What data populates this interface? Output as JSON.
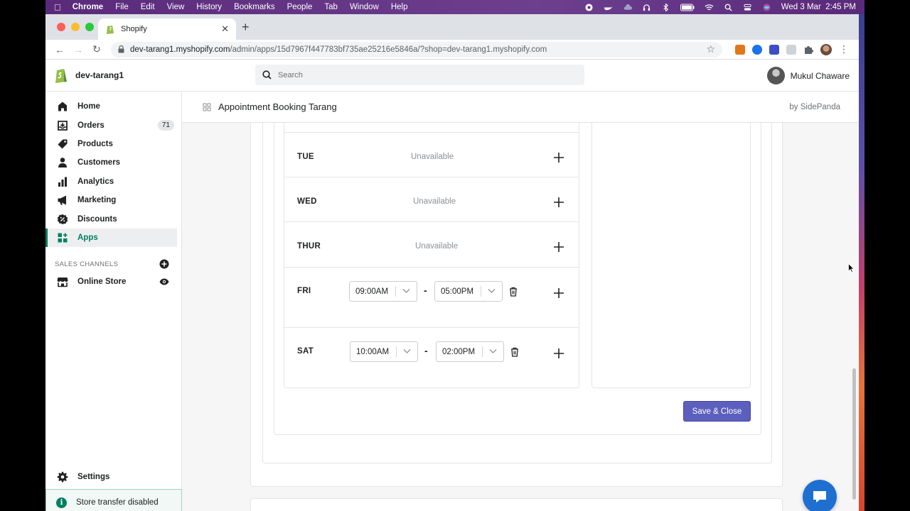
{
  "menubar": {
    "items": [
      "Chrome",
      "File",
      "Edit",
      "View",
      "History",
      "Bookmarks",
      "People",
      "Tab",
      "Window",
      "Help"
    ],
    "datetime": "Wed 3 Mar  2:45 PM"
  },
  "browser": {
    "tab_title": "Shopify",
    "url_host": "dev-tarang1.myshopify.com",
    "url_path": "/admin/apps/15d7967f447783bf735ae25216e5846a/?shop=dev-tarang1.myshopify.com"
  },
  "topbar": {
    "store_name": "dev-tarang1",
    "search_placeholder": "Search",
    "user_name": "Mukul Chaware"
  },
  "sidebar": {
    "items": [
      {
        "label": "Home",
        "icon": "home-icon"
      },
      {
        "label": "Orders",
        "icon": "orders-icon",
        "badge": "71"
      },
      {
        "label": "Products",
        "icon": "tag-icon"
      },
      {
        "label": "Customers",
        "icon": "person-icon"
      },
      {
        "label": "Analytics",
        "icon": "bar-chart-icon"
      },
      {
        "label": "Marketing",
        "icon": "megaphone-icon"
      },
      {
        "label": "Discounts",
        "icon": "discount-icon"
      },
      {
        "label": "Apps",
        "icon": "apps-icon",
        "active": true
      }
    ],
    "sales_channels_label": "SALES CHANNELS",
    "online_store_label": "Online Store",
    "settings_label": "Settings",
    "store_transfer_label": "Store transfer disabled"
  },
  "app": {
    "title": "Appointment Booking Tarang",
    "by": "by SidePanda"
  },
  "schedule": {
    "days": [
      {
        "day": "TUE",
        "status": "Unavailable"
      },
      {
        "day": "WED",
        "status": "Unavailable"
      },
      {
        "day": "THUR",
        "status": "Unavailable"
      },
      {
        "day": "FRI",
        "start": "09:00AM",
        "end": "05:00PM"
      },
      {
        "day": "SAT",
        "start": "10:00AM",
        "end": "02:00PM"
      }
    ],
    "separator": "-",
    "save_label": "Save & Close"
  },
  "colors": {
    "accent": "#5c5fbd",
    "shopify_green": "#008060",
    "chat": "#1f6fd0"
  }
}
